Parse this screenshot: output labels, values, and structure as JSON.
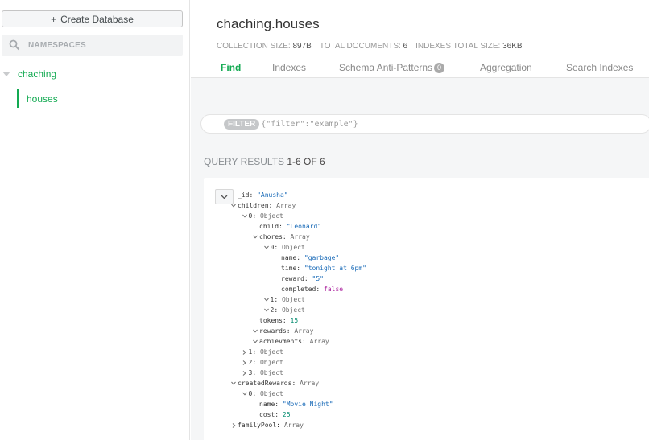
{
  "sidebar": {
    "create_button": "Create Database",
    "create_icon": "+",
    "search_placeholder": "NAMESPACES",
    "database": "chaching",
    "collection": "houses"
  },
  "header": {
    "title": "chaching.houses",
    "collection_size_label": "COLLECTION SIZE:",
    "collection_size": "897B",
    "total_documents_label": "TOTAL DOCUMENTS:",
    "total_documents": "6",
    "indexes_size_label": "INDEXES TOTAL SIZE:",
    "indexes_size": "36KB",
    "tabs": [
      {
        "label": "Find"
      },
      {
        "label": "Indexes"
      },
      {
        "label": "Schema Anti-Patterns",
        "badge": "0"
      },
      {
        "label": "Aggregation"
      },
      {
        "label": "Search Indexes"
      }
    ]
  },
  "filter": {
    "pill": "FILTER",
    "placeholder": "{\"filter\":\"example\"}"
  },
  "results": {
    "label": "QUERY RESULTS",
    "range": "1-6 OF 6"
  },
  "document": [
    {
      "indent": 0,
      "toggle": "",
      "key": "_id",
      "value": "\"Anusha\"",
      "type": "string"
    },
    {
      "indent": 0,
      "toggle": "open",
      "key": "children",
      "value": "Array",
      "type": "type"
    },
    {
      "indent": 1,
      "toggle": "open",
      "key": "0",
      "value": "Object",
      "type": "type"
    },
    {
      "indent": 2,
      "toggle": "",
      "key": "child",
      "value": "\"Leonard\"",
      "type": "string"
    },
    {
      "indent": 2,
      "toggle": "open",
      "key": "chores",
      "value": "Array",
      "type": "type"
    },
    {
      "indent": 3,
      "toggle": "open",
      "key": "0",
      "value": "Object",
      "type": "type"
    },
    {
      "indent": 4,
      "toggle": "",
      "key": "name",
      "value": "\"garbage\"",
      "type": "string"
    },
    {
      "indent": 4,
      "toggle": "",
      "key": "time",
      "value": "\"tonight at 6pm\"",
      "type": "string"
    },
    {
      "indent": 4,
      "toggle": "",
      "key": "reward",
      "value": "\"5\"",
      "type": "string"
    },
    {
      "indent": 4,
      "toggle": "",
      "key": "completed",
      "value": "false",
      "type": "bool"
    },
    {
      "indent": 3,
      "toggle": "open",
      "key": "1",
      "value": "Object",
      "type": "type"
    },
    {
      "indent": 3,
      "toggle": "open",
      "key": "2",
      "value": "Object",
      "type": "type"
    },
    {
      "indent": 2,
      "toggle": "",
      "key": "tokens",
      "value": "15",
      "type": "number"
    },
    {
      "indent": 2,
      "toggle": "open",
      "key": "rewards",
      "value": "Array",
      "type": "type"
    },
    {
      "indent": 2,
      "toggle": "open",
      "key": "achievments",
      "value": "Array",
      "type": "type"
    },
    {
      "indent": 1,
      "toggle": "closed",
      "key": "1",
      "value": "Object",
      "type": "type"
    },
    {
      "indent": 1,
      "toggle": "closed",
      "key": "2",
      "value": "Object",
      "type": "type"
    },
    {
      "indent": 1,
      "toggle": "closed",
      "key": "3",
      "value": "Object",
      "type": "type"
    },
    {
      "indent": 0,
      "toggle": "open",
      "key": "createdRewards",
      "value": "Array",
      "type": "type"
    },
    {
      "indent": 1,
      "toggle": "open",
      "key": "0",
      "value": "Object",
      "type": "type"
    },
    {
      "indent": 2,
      "toggle": "",
      "key": "name",
      "value": "\"Movie Night\"",
      "type": "string"
    },
    {
      "indent": 2,
      "toggle": "",
      "key": "cost",
      "value": "25",
      "type": "number"
    },
    {
      "indent": 0,
      "toggle": "closed",
      "key": "familyPool",
      "value": "Array",
      "type": "type"
    }
  ],
  "colors": {
    "accent": "#13aa52",
    "string": "#1a6bb8",
    "number": "#008a6d",
    "boolean": "#aa1f9c"
  },
  "icons": {
    "search": "search-icon",
    "caret": "caret-down-icon",
    "collapse": "chevron-down-icon"
  }
}
